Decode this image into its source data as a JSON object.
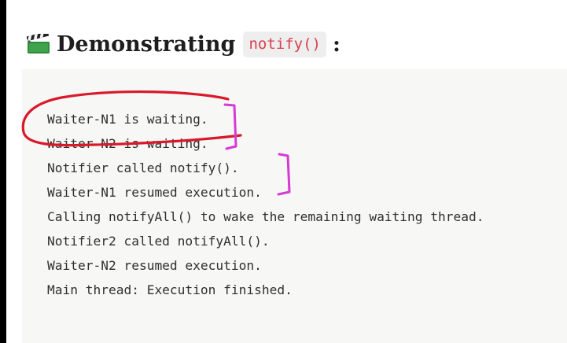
{
  "section": {
    "icon": "clapperboard-icon",
    "title": "Demonstrating",
    "code": "notify()",
    "suffix": ":"
  },
  "output": {
    "lines": [
      "Waiter-N1 is waiting.",
      "Waiter-N2 is waiting.",
      "Notifier called notify().",
      "Waiter-N1 resumed execution.",
      "Calling notifyAll() to wake the remaining waiting thread.",
      "Notifier2 called notifyAll().",
      "Waiter-N2 resumed execution.",
      "Main thread: Execution finished."
    ]
  },
  "annotations": {
    "circle_color": "#d9182a",
    "bracket_color": "#d53ad6"
  },
  "colors": {
    "code_chip_text": "#d6414e",
    "code_block_bg": "#f7f7f5",
    "heading_text": "#1e1e1e"
  }
}
